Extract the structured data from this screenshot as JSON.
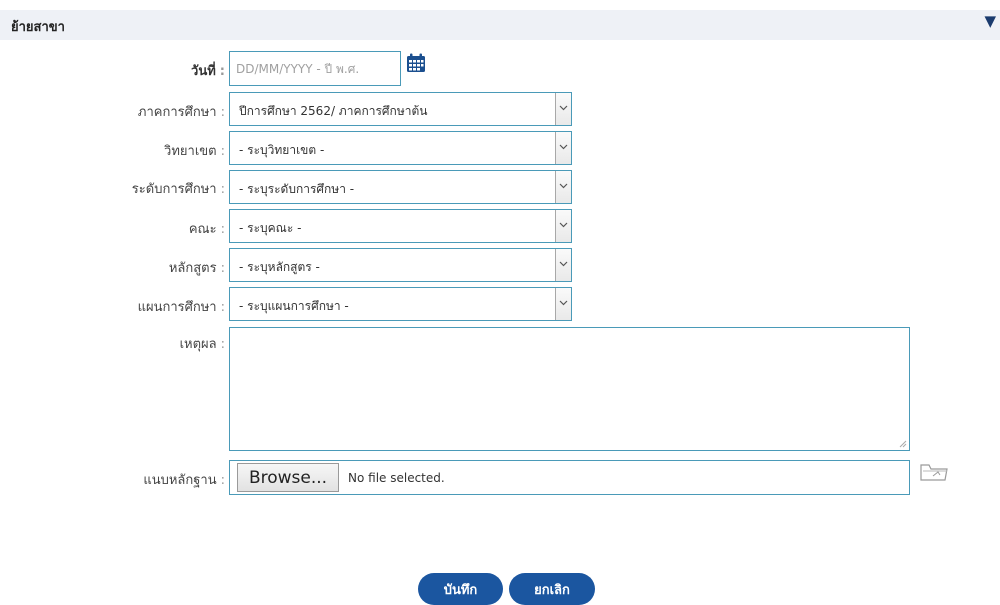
{
  "header": {
    "title": "ย้ายสาขา",
    "toggle_icon": "▼"
  },
  "form": {
    "date": {
      "label": "วันที่",
      "placeholder": "DD/MM/YYYY - ปี พ.ศ."
    },
    "semester": {
      "label": "ภาคการศึกษา",
      "value": "ปีการศึกษา 2562/ ภาคการศึกษาต้น"
    },
    "campus": {
      "label": "วิทยาเขต",
      "value": "- ระบุวิทยาเขต -"
    },
    "level": {
      "label": "ระดับการศึกษา",
      "value": "- ระบุระดับการศึกษา -"
    },
    "faculty": {
      "label": "คณะ",
      "value": "- ระบุคณะ -"
    },
    "curriculum": {
      "label": "หลักสูตร",
      "value": "- ระบุหลักสูตร -"
    },
    "study_plan": {
      "label": "แผนการศึกษา",
      "value": "- ระบุแผนการศึกษา -"
    },
    "reason": {
      "label": "เหตุผล",
      "value": ""
    },
    "attachment": {
      "label": "แนบหลักฐาน",
      "browse_label": "Browse...",
      "status": "No file selected."
    },
    "colon": ":"
  },
  "actions": {
    "save_label": "บันทึก",
    "cancel_label": "ยกเลิก"
  },
  "colors": {
    "accent": "#1b56a0",
    "input_border": "#4a9ab8",
    "header_bg": "#eef1f6"
  },
  "icons": {
    "date": "calendar-icon",
    "select": "chevron-down-icon",
    "attach": "attachment-icon"
  }
}
